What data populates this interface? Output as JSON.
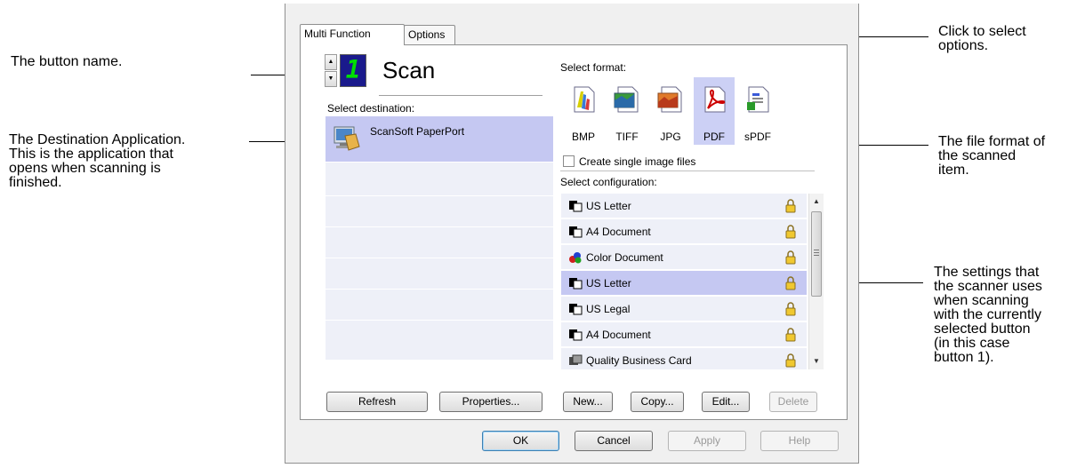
{
  "callouts": {
    "button_name": "The button name.",
    "destination_line1": "The Destination Application.",
    "destination_line2": "This is the application that",
    "destination_line3": "opens when scanning is",
    "destination_line4": "finished.",
    "options_line1": "Click to select",
    "options_line2": "options.",
    "format_line1": "The file format of",
    "format_line2": "the scanned",
    "format_line3": "item.",
    "settings_line1": "The settings that",
    "settings_line2": "the scanner uses",
    "settings_line3": "when scanning",
    "settings_line4": "with the currently",
    "settings_line5": "selected button",
    "settings_line6": "(in this case",
    "settings_line7": "button 1)."
  },
  "tabs": [
    {
      "label": "Multi Function",
      "active": true
    },
    {
      "label": "Options",
      "active": false
    }
  ],
  "button_selector": {
    "number": "1",
    "name": "Scan"
  },
  "destination": {
    "label": "Select destination:",
    "items": [
      {
        "name": "ScanSoft PaperPort",
        "icon": "paperport-icon"
      }
    ]
  },
  "format": {
    "label": "Select format:",
    "items": [
      {
        "label": "BMP",
        "icon": "bmp-icon"
      },
      {
        "label": "TIFF",
        "icon": "tiff-icon"
      },
      {
        "label": "JPG",
        "icon": "jpg-icon"
      },
      {
        "label": "PDF",
        "icon": "pdf-icon",
        "selected": true
      },
      {
        "label": "sPDF",
        "icon": "spdf-icon"
      }
    ],
    "single_image_label": "Create single image files",
    "single_image_checked": false
  },
  "configuration": {
    "label": "Select configuration:",
    "items": [
      {
        "label": "US Letter",
        "icon": "bw-document-icon"
      },
      {
        "label": "A4 Document",
        "icon": "bw-document-icon"
      },
      {
        "label": "Color Document",
        "icon": "color-document-icon"
      },
      {
        "label": "US Letter",
        "icon": "bw-document-icon",
        "selected": true
      },
      {
        "label": "US Legal",
        "icon": "bw-document-icon"
      },
      {
        "label": "A4 Document",
        "icon": "bw-document-icon"
      },
      {
        "label": "Quality Business Card",
        "icon": "business-card-icon"
      }
    ]
  },
  "buttons": {
    "refresh": "Refresh",
    "properties": "Properties...",
    "new": "New...",
    "copy": "Copy...",
    "edit": "Edit...",
    "delete": "Delete",
    "ok": "OK",
    "cancel": "Cancel",
    "apply": "Apply",
    "help": "Help"
  },
  "colors": {
    "selection": "#c5c8f2",
    "list_bg": "#eef0f8",
    "lcd_bg": "#1a1a8c",
    "lcd_digit": "#00e000"
  }
}
